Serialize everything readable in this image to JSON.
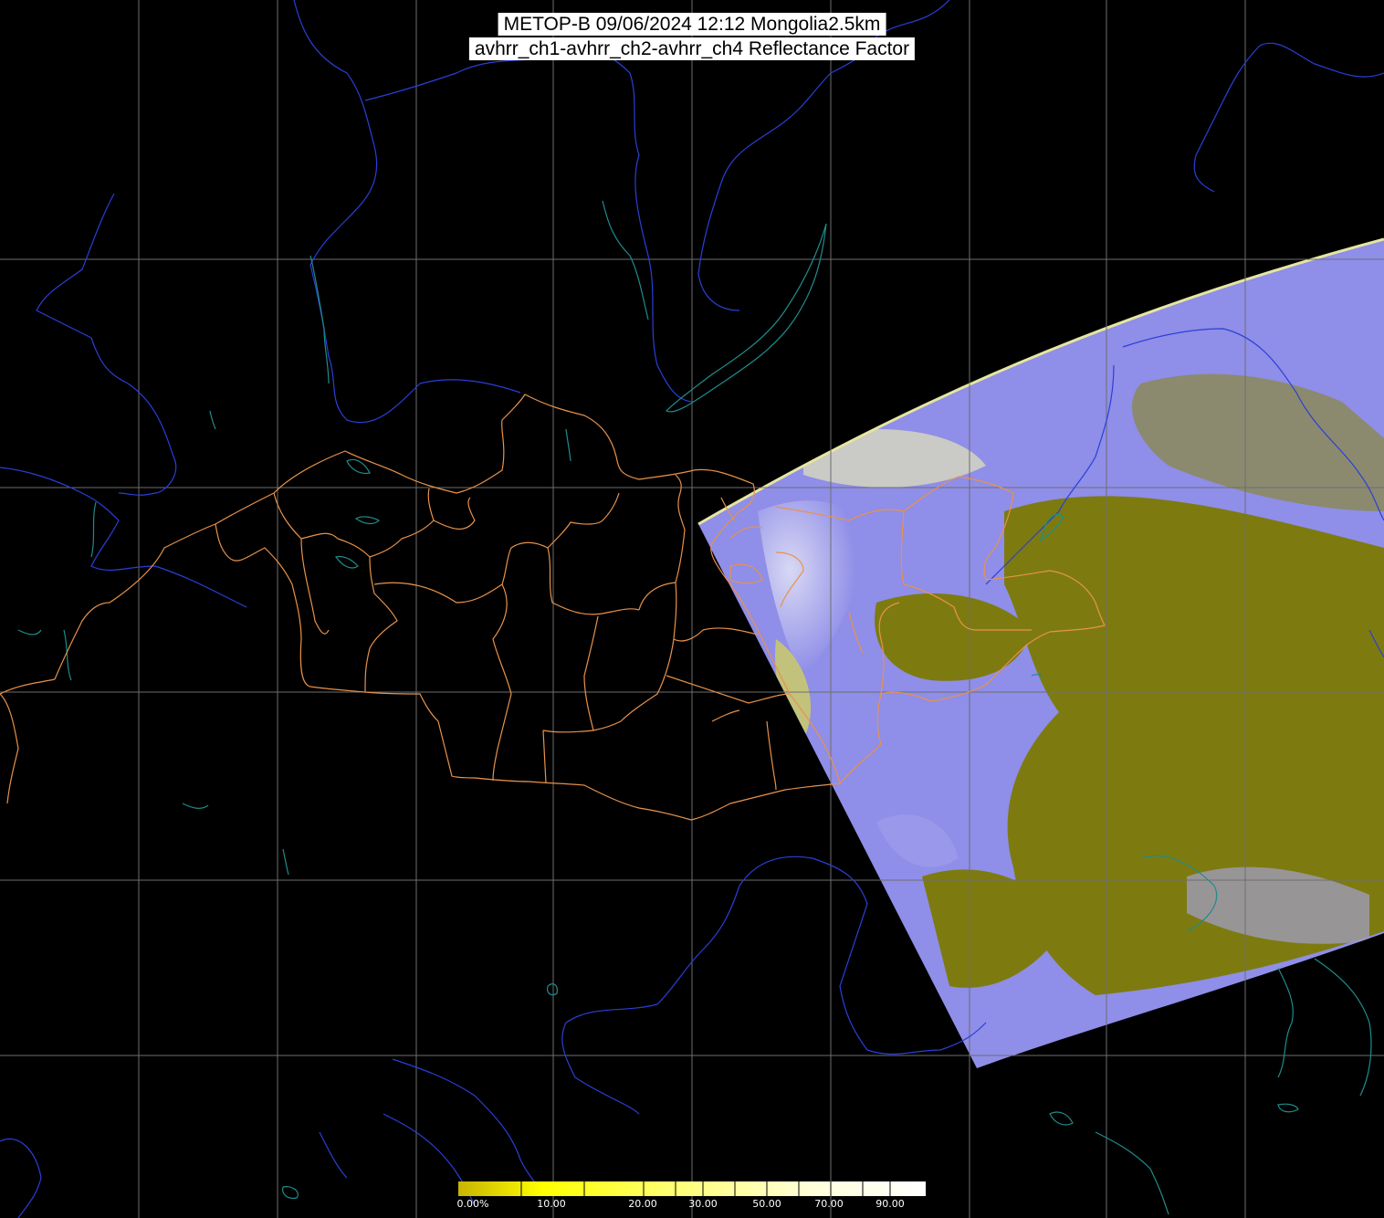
{
  "title": {
    "line1": "METOP-B 09/06/2024 12:12 Mongolia2.5km",
    "line2": "avhrr_ch1-avhrr_ch2-avhrr_ch4 Reflectance Factor"
  },
  "colorbar": {
    "ticks": [
      "0.00%",
      "10.00",
      "20.00",
      "30.00",
      "50.00",
      "70.00",
      "90.00"
    ],
    "colors": [
      "#d9c400",
      "#f2ea00",
      "#ffff00",
      "#ffff66",
      "#ffffaa",
      "#ffffdd",
      "#ffffff"
    ]
  },
  "colors": {
    "background": "#000000",
    "graticule": "#6e6e6e",
    "rivers_coast": "#2a3fd8",
    "lakes": "#1f8c8c",
    "admin_borders": "#e8924a",
    "swath_clear": "#7d7b10",
    "swath_cloud": "#8f8ee8"
  }
}
